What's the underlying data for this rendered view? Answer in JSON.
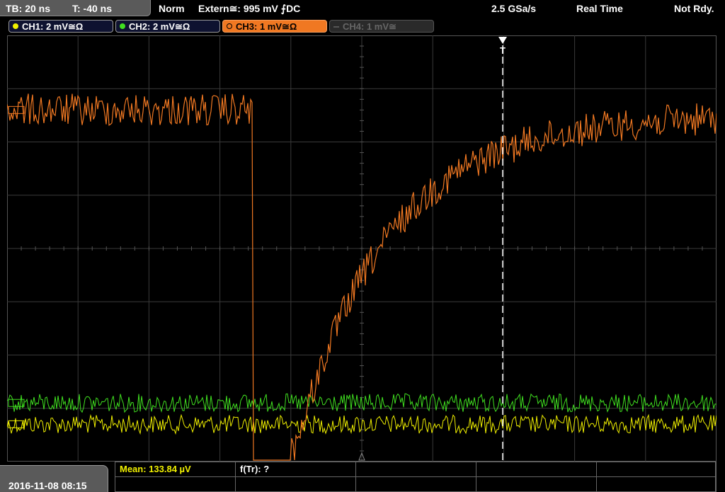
{
  "status_bar": {
    "timebase": "TB: 20 ns",
    "trigger_time": "T: -40 ns",
    "trigger_mode": "Norm",
    "trigger_source": "Extern≅: 995 mV ⨍DC",
    "sample_rate": "2.5 GSa/s",
    "acq_mode": "Real Time",
    "status": "Not Rdy."
  },
  "channels": [
    {
      "label": "CH1: 2 mV≅Ω",
      "color": "#f0f000",
      "state": "on"
    },
    {
      "label": "CH2: 2 mV≅Ω",
      "color": "#40e020",
      "state": "on"
    },
    {
      "label": "CH3: 1 mV≅Ω",
      "color": "#f07822",
      "state": "active"
    },
    {
      "label": "CH4: 1 mV≅",
      "color": "#666666",
      "state": "off"
    }
  ],
  "trigger_marker": "T",
  "measurements": {
    "mean_label": "Mean: 133.84 µV",
    "mean_color": "#f0f000",
    "rise_label": "f(Tr): ?"
  },
  "timestamp": "2016-11-08 08:15",
  "colors": {
    "grid": "#3a3a3a",
    "ch1": "#f0f000",
    "ch2": "#40e020",
    "ch3": "#f07822"
  },
  "chart_data": {
    "type": "line",
    "grid": {
      "x_divisions": 10,
      "y_divisions": 8,
      "on": true
    },
    "series": [
      {
        "name": "CH3",
        "shape": "step-then-exponential-rise",
        "level_before_div": 2.6,
        "dip_to_div": -4.0,
        "level_after_div": 2.5
      },
      {
        "name": "CH2",
        "shape": "noise",
        "level_div": -2.9
      },
      {
        "name": "CH1",
        "shape": "noise",
        "level_div": -3.3
      }
    ]
  }
}
